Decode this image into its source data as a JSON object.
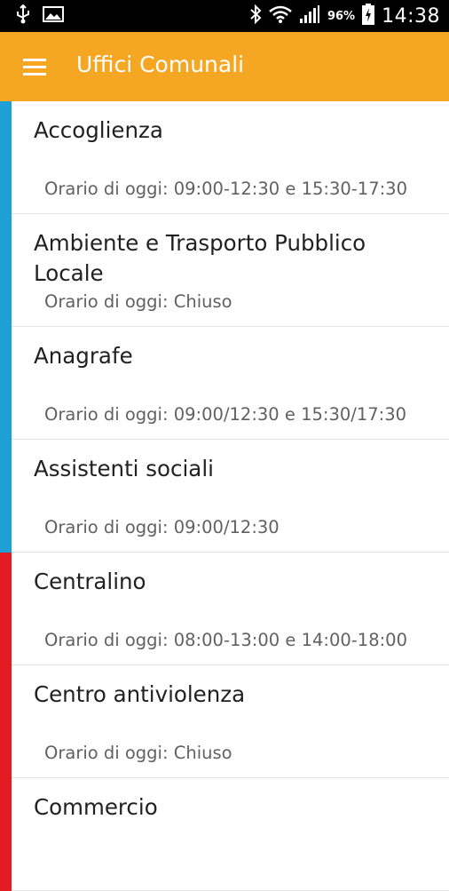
{
  "status_bar": {
    "battery_percent": "96%",
    "time": "14:38"
  },
  "app_bar": {
    "title": "Uffici Comunali"
  },
  "colors": {
    "app_bar": "#F5A623",
    "category_blue": "#1E9FD6",
    "category_red": "#E31B23"
  },
  "offices": [
    {
      "name": "Accoglienza",
      "hours": "Orario di oggi: 09:00-12:30 e 15:30-17:30",
      "color": "#1E9FD6"
    },
    {
      "name": "Ambiente e Trasporto Pubblico Locale",
      "hours": "Orario di oggi: Chiuso",
      "color": "#1E9FD6"
    },
    {
      "name": "Anagrafe",
      "hours": "Orario di oggi: 09:00/12:30 e 15:30/17:30",
      "color": "#1E9FD6"
    },
    {
      "name": "Assistenti sociali",
      "hours": "Orario di oggi: 09:00/12:30",
      "color": "#1E9FD6"
    },
    {
      "name": "Centralino",
      "hours": "Orario di oggi: 08:00-13:00 e 14:00-18:00",
      "color": "#E31B23"
    },
    {
      "name": "Centro antiviolenza",
      "hours": "Orario di oggi: Chiuso",
      "color": "#E31B23"
    },
    {
      "name": "Commercio",
      "hours": "",
      "color": "#E31B23"
    }
  ]
}
